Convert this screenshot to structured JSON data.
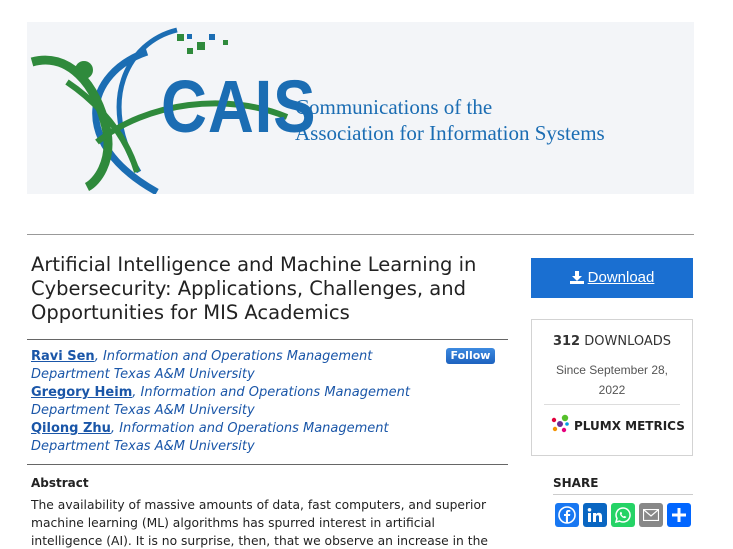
{
  "banner": {
    "logo_text": "CAIS",
    "tagline_line1": "Communications of the",
    "tagline_line2": "Association for Information Systems"
  },
  "article": {
    "title": "Artificial Intelligence and Machine Learning in Cybersecurity: Applications, Challenges, and Opportunities for MIS Academics"
  },
  "authors": [
    {
      "name": "Ravi Sen",
      "affiliation": "Information and Operations Management Department Texas A&M University"
    },
    {
      "name": "Gregory Heim",
      "affiliation": "Information and Operations Management Department Texas A&M University"
    },
    {
      "name": "Qilong Zhu",
      "affiliation": "Information and Operations Management Department Texas A&M University"
    }
  ],
  "follow_label": "Follow",
  "abstract": {
    "heading": "Abstract",
    "text": "The availability of massive amounts of data, fast computers, and superior machine learning (ML) algorithms has spurred interest in artificial intelligence (AI). It is no surprise, then, that we observe an increase in the application of AI in"
  },
  "sidebar": {
    "download_label": "Download",
    "downloads_count": "312",
    "downloads_label": "DOWNLOADS",
    "since_text": "Since September 28, 2022",
    "plumx_label": "PLUMX METRICS",
    "share_label": "SHARE",
    "share_buttons": [
      "facebook-icon",
      "linkedin-icon",
      "whatsapp-icon",
      "email-icon",
      "share-icon"
    ]
  },
  "colors": {
    "brand_blue": "#1b6db3",
    "brand_green": "#2f8a3c",
    "link_blue": "#1a56a8",
    "download_blue": "#1a6fd1",
    "facebook": "#1877f2",
    "linkedin": "#0a66c2",
    "whatsapp": "#25d366",
    "email": "#888888",
    "share": "#0166ff"
  }
}
